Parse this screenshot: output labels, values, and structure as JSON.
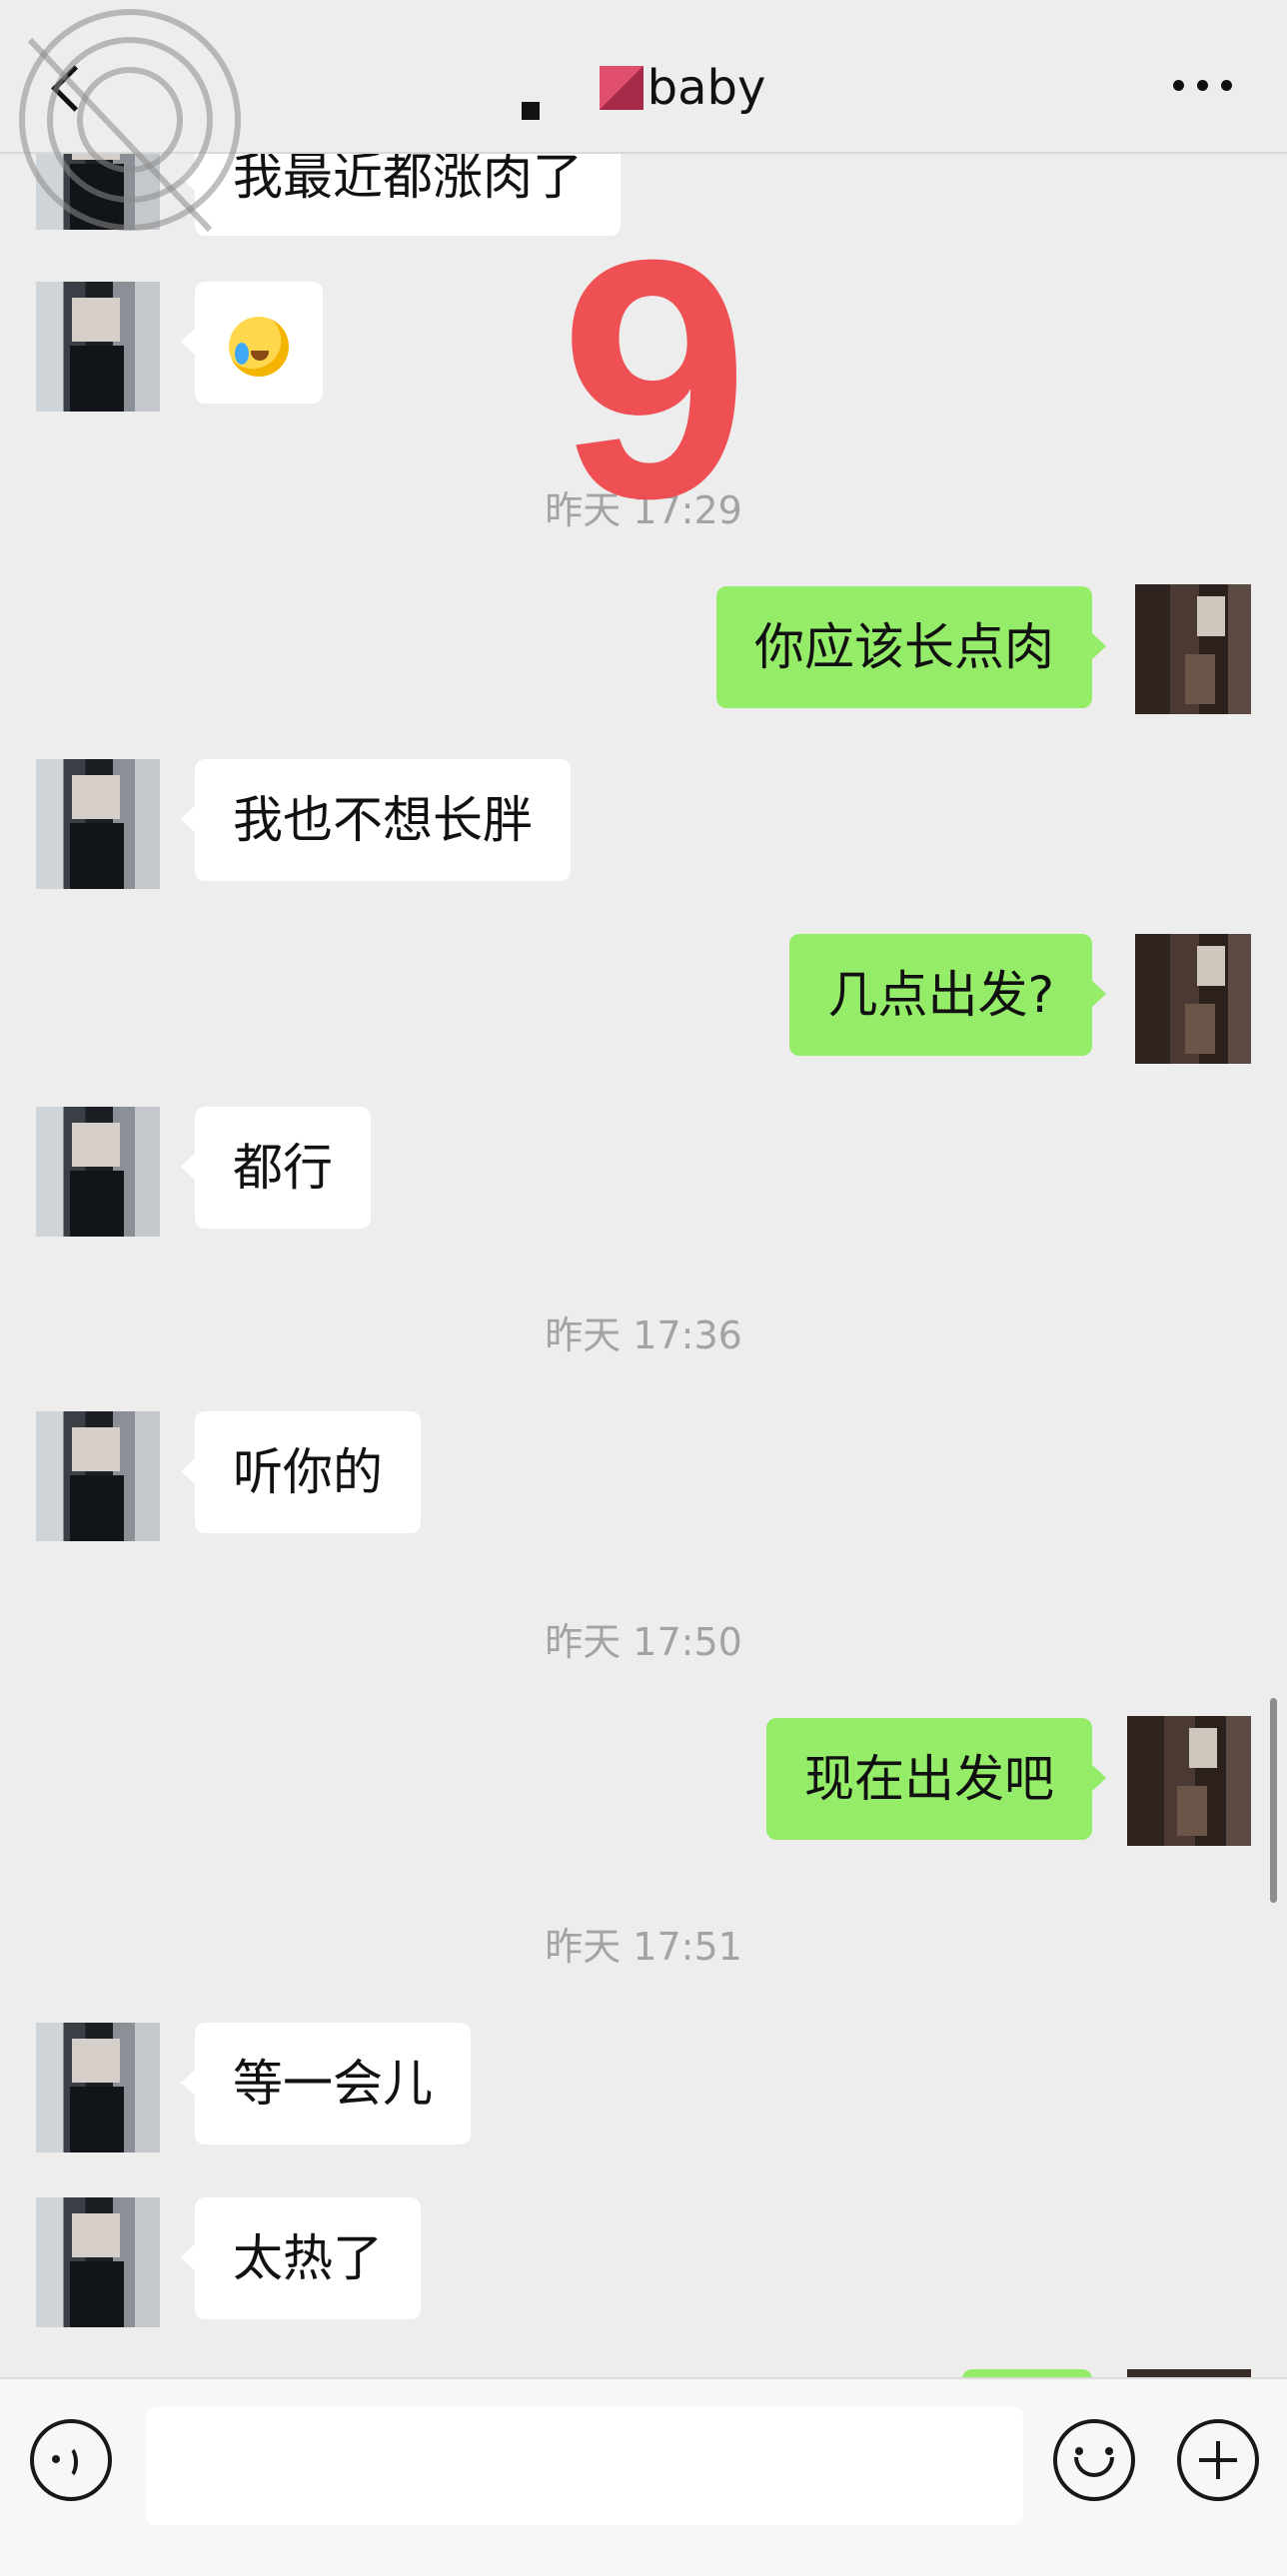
{
  "header": {
    "title": "baby",
    "back_icon": "chevron-left-icon",
    "more_icon": "more-dots-icon"
  },
  "overlay": {
    "number": "9",
    "number_color": "#ef4b50"
  },
  "messages": [
    {
      "side": "left",
      "text": "我最近都涨肉了"
    },
    {
      "side": "left",
      "emoji": "crying-laughing-emoji"
    },
    {
      "timestamp": "昨天 17:29"
    },
    {
      "side": "right",
      "text": "你应该长点肉"
    },
    {
      "side": "left",
      "text": "我也不想长胖"
    },
    {
      "side": "right",
      "text": "几点出发?"
    },
    {
      "side": "left",
      "text": "都行"
    },
    {
      "timestamp": "昨天 17:36"
    },
    {
      "side": "left",
      "text": "听你的"
    },
    {
      "timestamp": "昨天 17:50"
    },
    {
      "side": "right",
      "text": "现在出发吧"
    },
    {
      "timestamp": "昨天 17:51"
    },
    {
      "side": "left",
      "text": "等一会儿"
    },
    {
      "side": "left",
      "text": "太热了"
    }
  ],
  "input_bar": {
    "voice_icon": "voice-icon",
    "input_value": "",
    "emoji_icon": "emoji-icon",
    "plus_icon": "plus-icon"
  },
  "colors": {
    "background": "#ededed",
    "bubble_self": "#95ec69",
    "bubble_other": "#ffffff",
    "timestamp": "#a3a3a3"
  }
}
